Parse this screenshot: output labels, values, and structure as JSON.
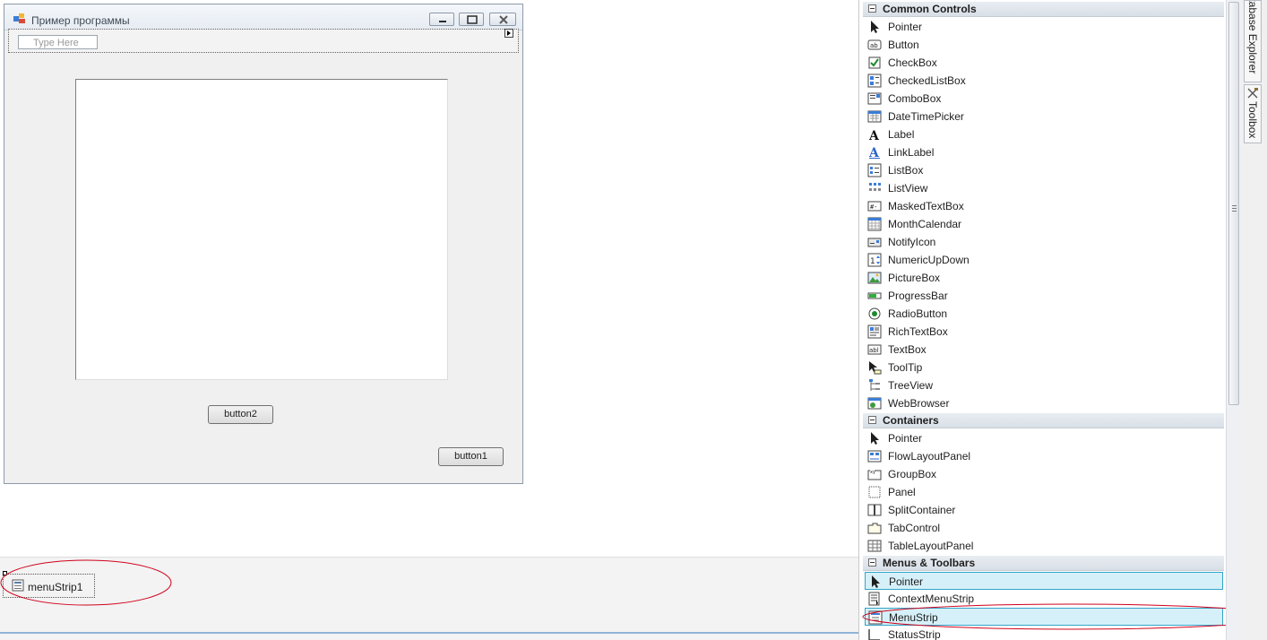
{
  "form": {
    "title": "Пример программы",
    "menu_placeholder": "Type Here",
    "button1_label": "button1",
    "button2_label": "button2"
  },
  "tray": {
    "component_label": "menuStrip1"
  },
  "toolbox": {
    "categories": [
      {
        "title": "Common Controls",
        "items": [
          {
            "label": "Pointer",
            "icon": "pointer-icon"
          },
          {
            "label": "Button",
            "icon": "button-icon"
          },
          {
            "label": "CheckBox",
            "icon": "checkbox-icon"
          },
          {
            "label": "CheckedListBox",
            "icon": "checkedlistbox-icon"
          },
          {
            "label": "ComboBox",
            "icon": "combobox-icon"
          },
          {
            "label": "DateTimePicker",
            "icon": "datetimepicker-icon"
          },
          {
            "label": "Label",
            "icon": "label-icon"
          },
          {
            "label": "LinkLabel",
            "icon": "linklabel-icon"
          },
          {
            "label": "ListBox",
            "icon": "listbox-icon"
          },
          {
            "label": "ListView",
            "icon": "listview-icon"
          },
          {
            "label": "MaskedTextBox",
            "icon": "maskedtextbox-icon"
          },
          {
            "label": "MonthCalendar",
            "icon": "monthcalendar-icon"
          },
          {
            "label": "NotifyIcon",
            "icon": "notifyicon-icon"
          },
          {
            "label": "NumericUpDown",
            "icon": "numericupdown-icon"
          },
          {
            "label": "PictureBox",
            "icon": "picturebox-icon"
          },
          {
            "label": "ProgressBar",
            "icon": "progressbar-icon"
          },
          {
            "label": "RadioButton",
            "icon": "radiobutton-icon"
          },
          {
            "label": "RichTextBox",
            "icon": "richtextbox-icon"
          },
          {
            "label": "TextBox",
            "icon": "textbox-icon"
          },
          {
            "label": "ToolTip",
            "icon": "tooltip-icon"
          },
          {
            "label": "TreeView",
            "icon": "treeview-icon"
          },
          {
            "label": "WebBrowser",
            "icon": "webbrowser-icon"
          }
        ]
      },
      {
        "title": "Containers",
        "items": [
          {
            "label": "Pointer",
            "icon": "pointer-icon"
          },
          {
            "label": "FlowLayoutPanel",
            "icon": "flowlayoutpanel-icon"
          },
          {
            "label": "GroupBox",
            "icon": "groupbox-icon"
          },
          {
            "label": "Panel",
            "icon": "panel-icon"
          },
          {
            "label": "SplitContainer",
            "icon": "splitcontainer-icon"
          },
          {
            "label": "TabControl",
            "icon": "tabcontrol-icon"
          },
          {
            "label": "TableLayoutPanel",
            "icon": "tablelayoutpanel-icon"
          }
        ]
      },
      {
        "title": "Menus & Toolbars",
        "items": [
          {
            "label": "Pointer",
            "icon": "pointer-icon",
            "selected": true
          },
          {
            "label": "ContextMenuStrip",
            "icon": "contextmenustrip-icon"
          },
          {
            "label": "MenuStrip",
            "icon": "menustrip-icon",
            "selected": true
          },
          {
            "label": "StatusStrip",
            "icon": "statusstrip-icon"
          }
        ]
      }
    ]
  },
  "side_tabs": {
    "database_explorer": "Database Explorer",
    "toolbox": "Toolbox"
  },
  "colors": {
    "selection_bg": "#d6f0f9",
    "selection_border": "#33a5c8",
    "annotation_ellipse": "#d0021b"
  }
}
